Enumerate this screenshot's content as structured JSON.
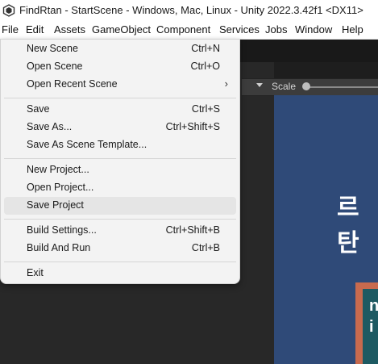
{
  "window": {
    "title": "FindRtan - StartScene - Windows, Mac, Linux - Unity 2022.3.42f1 <DX11>"
  },
  "menubar": {
    "items": [
      "File",
      "Edit",
      "Assets",
      "GameObject",
      "Component",
      "Services",
      "Jobs",
      "Window",
      "Help"
    ]
  },
  "file_menu": {
    "new_scene": {
      "label": "New Scene",
      "shortcut": "Ctrl+N"
    },
    "open_scene": {
      "label": "Open Scene",
      "shortcut": "Ctrl+O"
    },
    "open_recent_scene": {
      "label": "Open Recent Scene",
      "submenu": "›"
    },
    "save": {
      "label": "Save",
      "shortcut": "Ctrl+S"
    },
    "save_as": {
      "label": "Save As...",
      "shortcut": "Ctrl+Shift+S"
    },
    "save_as_scene_template": {
      "label": "Save As Scene Template..."
    },
    "new_project": {
      "label": "New Project..."
    },
    "open_project": {
      "label": "Open Project..."
    },
    "save_project": {
      "label": "Save Project"
    },
    "build_settings": {
      "label": "Build Settings...",
      "shortcut": "Ctrl+Shift+B"
    },
    "build_and_run": {
      "label": "Build And Run",
      "shortcut": "Ctrl+B"
    },
    "exit": {
      "label": "Exit"
    }
  },
  "scene_toolbar": {
    "scale_label": "Scale"
  },
  "game_view": {
    "title_text": "르탄",
    "card_text": "n i"
  },
  "colors": {
    "game_background": "#2f4a78",
    "card_border": "#c86a4e",
    "card_fill": "#1e5a62",
    "menu_hover": "#e5e5e5"
  }
}
